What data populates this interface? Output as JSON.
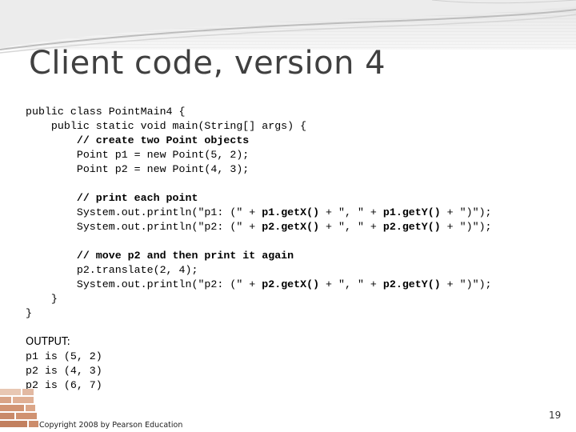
{
  "slide": {
    "title": "Client code, version 4",
    "code_lines": [
      {
        "text": "public class PointMain4 {",
        "style": "plain"
      },
      {
        "text": "    public static void main(String[] args) {",
        "style": "plain"
      },
      {
        "text": "        // create two Point objects",
        "style": "comment"
      },
      {
        "text": "        Point p1 = new Point(5, 2);",
        "style": "plain"
      },
      {
        "text": "        Point p2 = new Point(4, 3);",
        "style": "plain"
      },
      {
        "text": "",
        "style": "plain"
      },
      {
        "text": "        // print each point",
        "style": "comment"
      },
      {
        "text": "        System.out.println(\"p1: (\" + p1.getX() + \", \" + p1.getY() + \")\");",
        "style": "mixed",
        "parts": [
          {
            "text": "        System.out.println(\"p1: (\" + ",
            "bold": false
          },
          {
            "text": "p1.getX()",
            "bold": true
          },
          {
            "text": " + \", \" + ",
            "bold": false
          },
          {
            "text": "p1.getY()",
            "bold": true
          },
          {
            "text": " + \")\");",
            "bold": false
          }
        ]
      },
      {
        "text": "        System.out.println(\"p2: (\" + p2.getX() + \", \" + p2.getY() + \")\");",
        "style": "mixed",
        "parts": [
          {
            "text": "        System.out.println(\"p2: (\" + ",
            "bold": false
          },
          {
            "text": "p2.getX()",
            "bold": true
          },
          {
            "text": " + \", \" + ",
            "bold": false
          },
          {
            "text": "p2.getY()",
            "bold": true
          },
          {
            "text": " + \")\");",
            "bold": false
          }
        ]
      },
      {
        "text": "",
        "style": "plain"
      },
      {
        "text": "        // move p2 and then print it again",
        "style": "comment"
      },
      {
        "text": "        p2.translate(2, 4);",
        "style": "plain"
      },
      {
        "text": "        System.out.println(\"p2: (\" + p2.getX() + \", \" + p2.getY() + \")\");",
        "style": "mixed",
        "parts": [
          {
            "text": "        System.out.println(\"p2: (\" + ",
            "bold": false
          },
          {
            "text": "p2.getX()",
            "bold": true
          },
          {
            "text": " + \", \" + ",
            "bold": false
          },
          {
            "text": "p2.getY()",
            "bold": true
          },
          {
            "text": " + \")\");",
            "bold": false
          }
        ]
      },
      {
        "text": "    }",
        "style": "plain"
      },
      {
        "text": "}",
        "style": "plain"
      }
    ],
    "output": {
      "label": "OUTPUT:",
      "lines": [
        "p1 is (5, 2)",
        "p2 is (4, 3)",
        "p2 is (6, 7)"
      ]
    },
    "footer": {
      "copyright": "Copyright 2008 by Pearson Education",
      "page_number": "19"
    },
    "colors": {
      "title": "#404040",
      "header_band": "#e9e9e9",
      "swoosh": "#bdbdbd",
      "bricks": "#c98a6a"
    }
  }
}
